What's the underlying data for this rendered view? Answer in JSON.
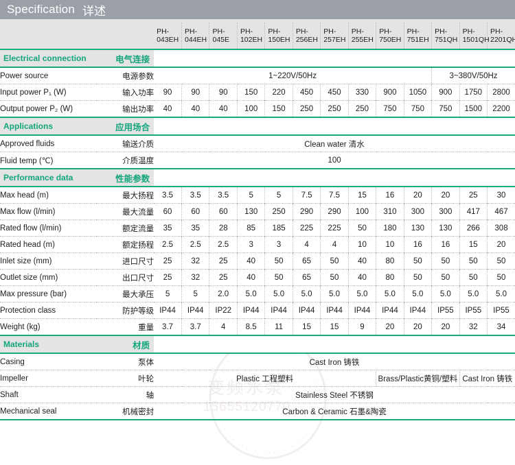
{
  "title": {
    "en": "Specification",
    "zh": "详述"
  },
  "models": [
    "PH-043EH",
    "PH-044EH",
    "PH-045E",
    "PH-102EH",
    "PH-150EH",
    "PH-256EH",
    "PH-257EH",
    "PH-255EH",
    "PH-750EH",
    "PH-751EH",
    "PH-751QH",
    "PH-1501QH",
    "PH-2201QH"
  ],
  "colors": {
    "accent_green": "#1aa87e",
    "title_bar": "#9ba0a8",
    "label_bg": "#d4d4d4",
    "header_bg": "#e4e4e4"
  },
  "sections": [
    {
      "en": "Electrical connection",
      "zh": "电气连接"
    },
    {
      "en": "Applications",
      "zh": "应用场合"
    },
    {
      "en": "Performance data",
      "zh": "性能参数"
    },
    {
      "en": "Materials",
      "zh": "材质"
    }
  ],
  "rows": {
    "power_source": {
      "en": "Power source",
      "zh": "电源参数",
      "spans": [
        {
          "text": "1~220V/50Hz",
          "cols": 10
        },
        {
          "text": "3~380V/50Hz",
          "cols": 3
        }
      ]
    },
    "input_power": {
      "en": "Input power P₁ (W)",
      "zh": "输入功率",
      "values": [
        "90",
        "90",
        "90",
        "150",
        "220",
        "450",
        "450",
        "330",
        "900",
        "1050",
        "900",
        "1750",
        "2800"
      ]
    },
    "output_power": {
      "en": "Output power P₂ (W)",
      "zh": "输出功率",
      "values": [
        "40",
        "40",
        "40",
        "100",
        "150",
        "250",
        "250",
        "250",
        "750",
        "750",
        "750",
        "1500",
        "2200"
      ]
    },
    "approved_fluids": {
      "en": "Approved fluids",
      "zh": "输送介质",
      "spans": [
        {
          "text": "Clean water  清水",
          "cols": 13
        }
      ]
    },
    "fluid_temp": {
      "en": "Fluid temp (℃)",
      "zh": "介质温度",
      "spans": [
        {
          "text": "100",
          "cols": 13
        }
      ]
    },
    "max_head": {
      "en": "Max head (m)",
      "zh": "最大扬程",
      "values": [
        "3.5",
        "3.5",
        "3.5",
        "5",
        "5",
        "7.5",
        "7.5",
        "15",
        "16",
        "20",
        "20",
        "25",
        "30"
      ]
    },
    "max_flow": {
      "en": "Max flow (l/min)",
      "zh": "最大流量",
      "values": [
        "60",
        "60",
        "60",
        "130",
        "250",
        "290",
        "290",
        "100",
        "310",
        "300",
        "300",
        "417",
        "467"
      ]
    },
    "rated_flow": {
      "en": "Rated flow (l/min)",
      "zh": "额定流量",
      "values": [
        "35",
        "35",
        "28",
        "85",
        "185",
        "225",
        "225",
        "50",
        "180",
        "130",
        "130",
        "266",
        "308"
      ]
    },
    "rated_head": {
      "en": "Rated head (m)",
      "zh": "额定扬程",
      "values": [
        "2.5",
        "2.5",
        "2.5",
        "3",
        "3",
        "4",
        "4",
        "10",
        "10",
        "16",
        "16",
        "15",
        "20"
      ]
    },
    "inlet_size": {
      "en": "Inlet size (mm)",
      "zh": "进口尺寸",
      "values": [
        "25",
        "32",
        "25",
        "40",
        "50",
        "65",
        "50",
        "40",
        "80",
        "50",
        "50",
        "50",
        "50"
      ]
    },
    "outlet_size": {
      "en": "Outlet size (mm)",
      "zh": "出口尺寸",
      "values": [
        "25",
        "32",
        "25",
        "40",
        "50",
        "65",
        "50",
        "40",
        "80",
        "50",
        "50",
        "50",
        "50"
      ]
    },
    "max_pressure": {
      "en": "Max pressure (bar)",
      "zh": "最大承压",
      "values": [
        "5",
        "5",
        "2.0",
        "5.0",
        "5.0",
        "5.0",
        "5.0",
        "5.0",
        "5.0",
        "5.0",
        "5.0",
        "5.0",
        "5.0"
      ]
    },
    "protection": {
      "en": "Protection class",
      "zh": "防护等级",
      "values": [
        "IP44",
        "IP44",
        "IP22",
        "IP44",
        "IP44",
        "IP44",
        "IP44",
        "IP44",
        "IP44",
        "IP44",
        "IP55",
        "IP55",
        "IP55"
      ]
    },
    "weight": {
      "en": "Weight  (kg)",
      "zh": "重量",
      "values": [
        "3.7",
        "3.7",
        "4",
        "8.5",
        "11",
        "15",
        "15",
        "9",
        "20",
        "20",
        "20",
        "32",
        "34"
      ]
    },
    "casing": {
      "en": "Casing",
      "zh": "泵体",
      "spans": [
        {
          "text": "Cast Iron  铸铁",
          "cols": 13
        }
      ]
    },
    "impeller": {
      "en": "Impeller",
      "zh": "叶轮",
      "spans": [
        {
          "text": "Plastic  工程塑料",
          "cols": 8
        },
        {
          "text": "Brass/Plastic黄铜/塑料",
          "cols": 3
        },
        {
          "text": "Cast Iron 铸铁",
          "cols": 2
        }
      ]
    },
    "shaft": {
      "en": "Shaft",
      "zh": "轴",
      "spans": [
        {
          "text": "Stainless Steel  不锈钢",
          "cols": 13
        }
      ]
    },
    "mech_seal": {
      "en": "Mechanical seal",
      "zh": "机械密封",
      "spans": [
        {
          "text": "Carbon & Ceramic  石墨&陶瓷",
          "cols": 13
        }
      ]
    }
  },
  "watermark": {
    "text_zh": "变频水泵",
    "phone": "15655120770"
  }
}
